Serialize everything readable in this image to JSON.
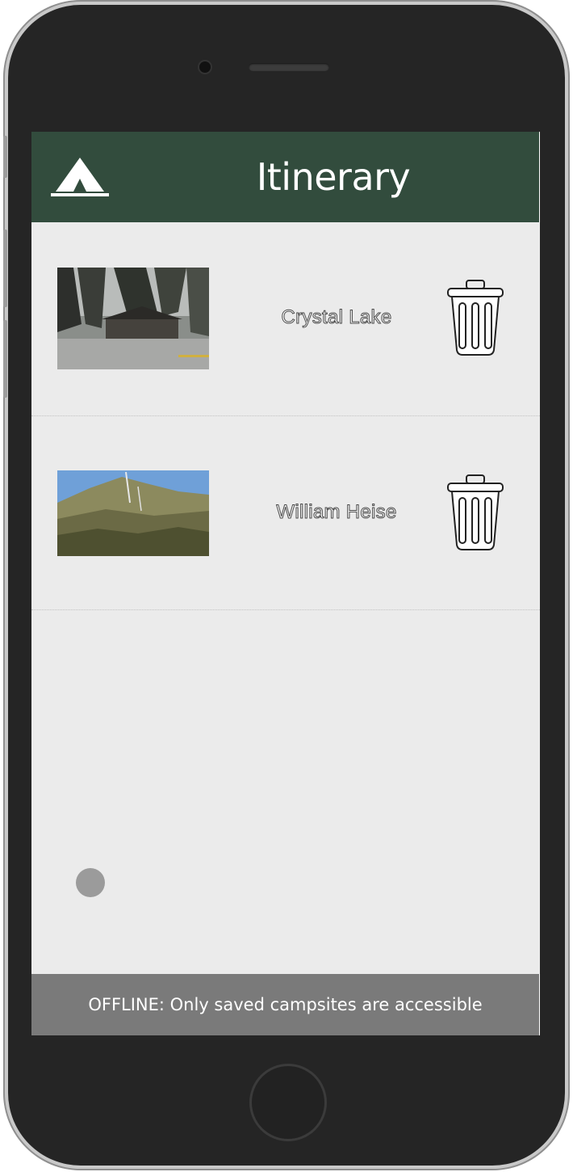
{
  "header": {
    "title": "Itinerary",
    "logo_icon": "tent-icon"
  },
  "itinerary": {
    "items": [
      {
        "name": "Crystal Lake",
        "thumbnail": "forest-lodge-photo",
        "delete_icon": "trash-icon"
      },
      {
        "name": "William Heise",
        "thumbnail": "hillside-photo",
        "delete_icon": "trash-icon"
      }
    ]
  },
  "status": {
    "offline_message": "OFFLINE: Only saved campsites are accessible"
  },
  "colors": {
    "header_bg": "#324c3d",
    "screen_bg": "#ebebeb",
    "offline_bg": "#7a7a7a",
    "fab": "#9b9b9b"
  }
}
